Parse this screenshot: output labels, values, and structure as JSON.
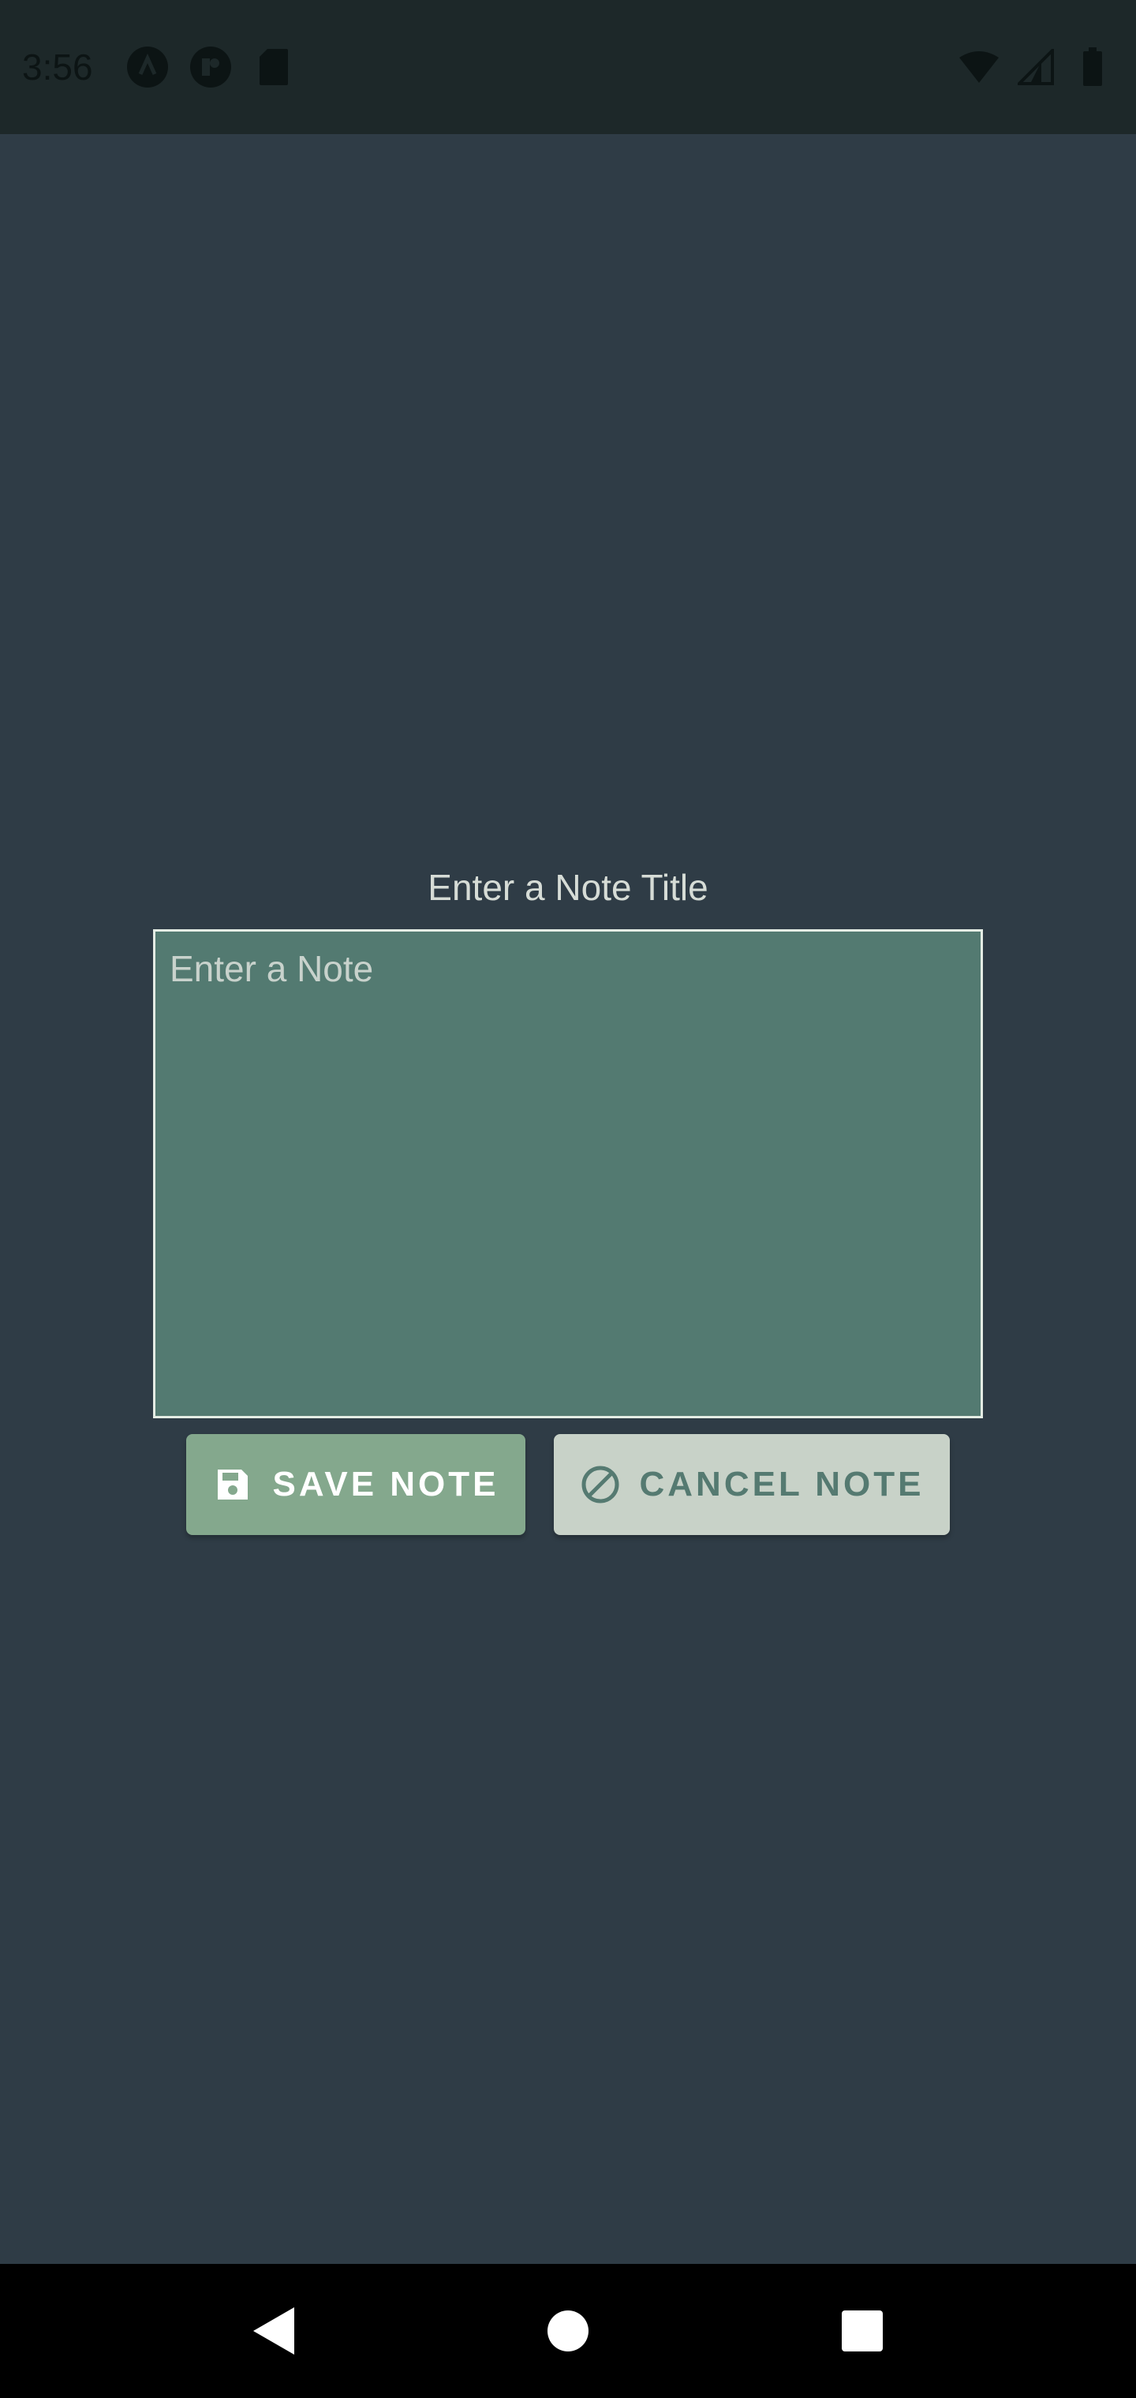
{
  "status_bar": {
    "time": "3:56",
    "icons_left": [
      "app-icon-a",
      "app-icon-b",
      "sd-card-icon"
    ],
    "icons_right": [
      "wifi-icon",
      "signal-icon",
      "battery-icon"
    ]
  },
  "editor": {
    "title": "Enter a Note Title",
    "note_placeholder": "Enter a Note",
    "note_value": ""
  },
  "actions": {
    "save_label": "SAVE NOTE",
    "save_icon": "floppy-disk-icon",
    "cancel_label": "CANCEL NOTE",
    "cancel_icon": "block-icon"
  },
  "nav": {
    "back_icon": "back-icon",
    "home_icon": "home-icon",
    "recents_icon": "recents-icon"
  },
  "colors": {
    "background": "#2f3c46",
    "note_area": "#537a71",
    "save_button": "#84a88d",
    "cancel_button": "#c8d2c8"
  }
}
